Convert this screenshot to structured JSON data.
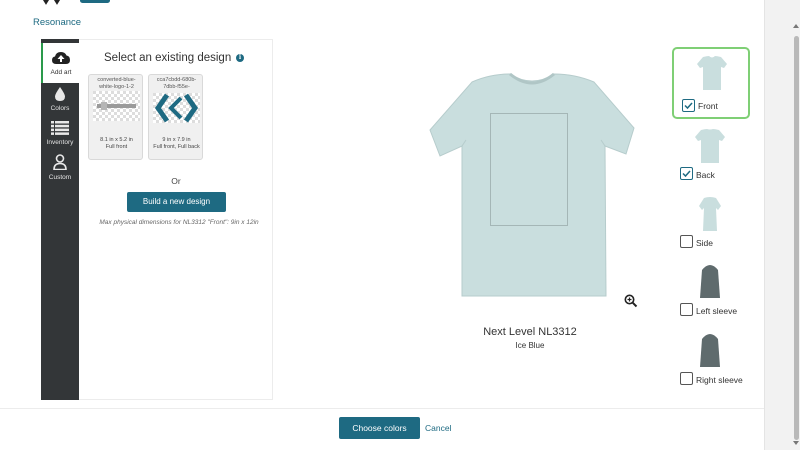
{
  "breadcrumb": "Resonance",
  "sidebar": {
    "items": [
      {
        "label": "Add art",
        "icon": "cloud-upload-icon"
      },
      {
        "label": "Colors",
        "icon": "droplet-icon"
      },
      {
        "label": "Inventory",
        "icon": "list-icon"
      },
      {
        "label": "Custom",
        "icon": "person-icon"
      }
    ]
  },
  "panel": {
    "title": "Select an existing design",
    "info": "i",
    "designs": [
      {
        "name": "converted-blue-white-logo-1-2",
        "size": "8.1 in x 5.2 in",
        "placement": "Full front"
      },
      {
        "name": "cca7cbdd-680b-7dbb-f55e-",
        "size": "9 in x 7.9 in",
        "placement": "Full front, Full back"
      }
    ],
    "or": "Or",
    "build_label": "Build a new design",
    "dims_note": "Max physical dimensions for NL3312 \"Front\": 9in x 12in"
  },
  "product": {
    "name": "Next Level NL3312",
    "color": "Ice Blue",
    "shirt_color": "#c9dede"
  },
  "views": [
    {
      "label": "Front",
      "checked": true
    },
    {
      "label": "Back",
      "checked": true
    },
    {
      "label": "Side",
      "checked": false
    },
    {
      "label": "Left sleeve",
      "checked": false
    },
    {
      "label": "Right sleeve",
      "checked": false
    }
  ],
  "footer": {
    "choose_label": "Choose colors",
    "cancel_label": "Cancel"
  },
  "colors": {
    "accent": "#1e6a82",
    "sidebar": "#333638",
    "selected_border": "#7fcf75"
  }
}
